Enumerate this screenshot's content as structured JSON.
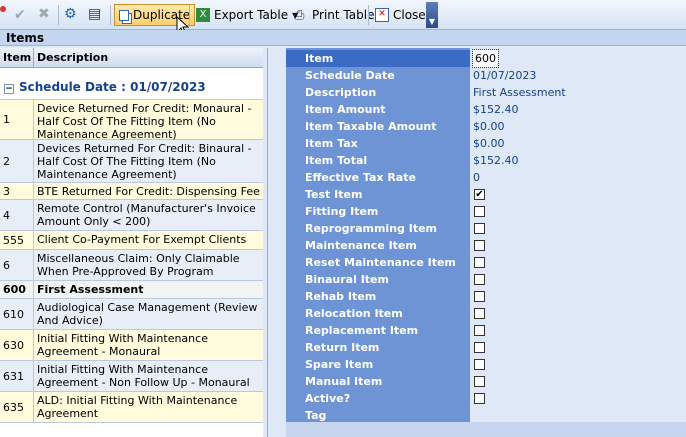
{
  "toolbar": {
    "duplicate_label": "Duplicate",
    "export_label": "Export Table",
    "print_label": "Print Table",
    "close_label": "Close"
  },
  "section_title": "Items",
  "grid": {
    "col_item": "Item",
    "col_desc": "Description",
    "group_label": "Schedule Date : 01/07/2023",
    "rows": [
      {
        "item": "1",
        "desc": "Device Returned For Credit: Monaural - Half Cost Of The Fitting Item (No Maintenance Agreement)"
      },
      {
        "item": "2",
        "desc": "Devices Returned For Credit: Binaural - Half Cost Of The Fitting Item (No Maintenance Agreement)"
      },
      {
        "item": "3",
        "desc": "BTE Returned For Credit: Dispensing Fee"
      },
      {
        "item": "4",
        "desc": "Remote Control (Manufacturer's Invoice Amount Only < 200)"
      },
      {
        "item": "555",
        "desc": "Client Co-Payment For Exempt Clients"
      },
      {
        "item": "6",
        "desc": "Miscellaneous Claim: Only Claimable When Pre-Approved By Program"
      },
      {
        "item": "600",
        "desc": "First Assessment"
      },
      {
        "item": "610",
        "desc": "Audiological Case Management (Review And Advice)"
      },
      {
        "item": "630",
        "desc": "Initial Fitting With Maintenance Agreement - Monaural"
      },
      {
        "item": "631",
        "desc": "Initial Fitting With Maintenance Agreement - Non Follow Up - Monaural"
      },
      {
        "item": "635",
        "desc": "ALD: Initial Fitting With Maintenance Agreement"
      }
    ]
  },
  "props": {
    "labels": [
      "Item",
      "Schedule Date",
      "Description",
      "Item Amount",
      "Item Taxable Amount",
      "Item Tax",
      "Item Total",
      "Effective Tax Rate",
      "Test Item",
      "Fitting Item",
      "Reprogramming Item",
      "Maintenance Item",
      "Reset Maintenance Item",
      "Binaural Item",
      "Rehab Item",
      "Relocation Item",
      "Replacement Item",
      "Return Item",
      "Spare Item",
      "Manual Item",
      "Active?",
      "Tag"
    ],
    "values": {
      "item": "600",
      "schedule_date": "01/07/2023",
      "description": "First Assessment",
      "item_amount": "$152.40",
      "item_taxable_amount": "$0.00",
      "item_tax": "$0.00",
      "item_total": "$152.40",
      "effective_tax_rate": "0"
    },
    "checkboxes": [
      true,
      false,
      false,
      false,
      false,
      false,
      false,
      false,
      false,
      false,
      false,
      false,
      false
    ]
  }
}
